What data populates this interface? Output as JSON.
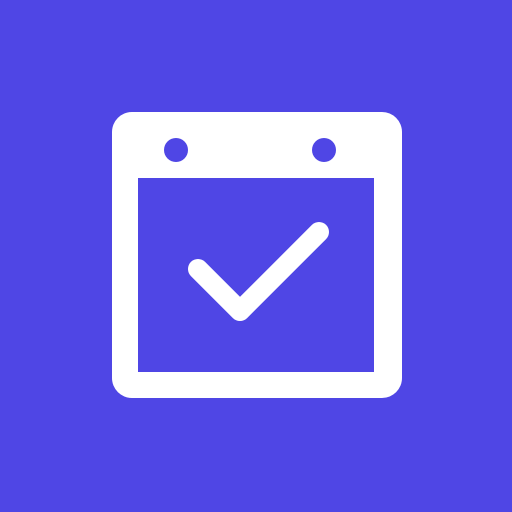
{
  "app_icon": {
    "icon": "calendar-check-icon",
    "colors": {
      "background": "#4f46e5",
      "foreground": "#ffffff"
    }
  }
}
